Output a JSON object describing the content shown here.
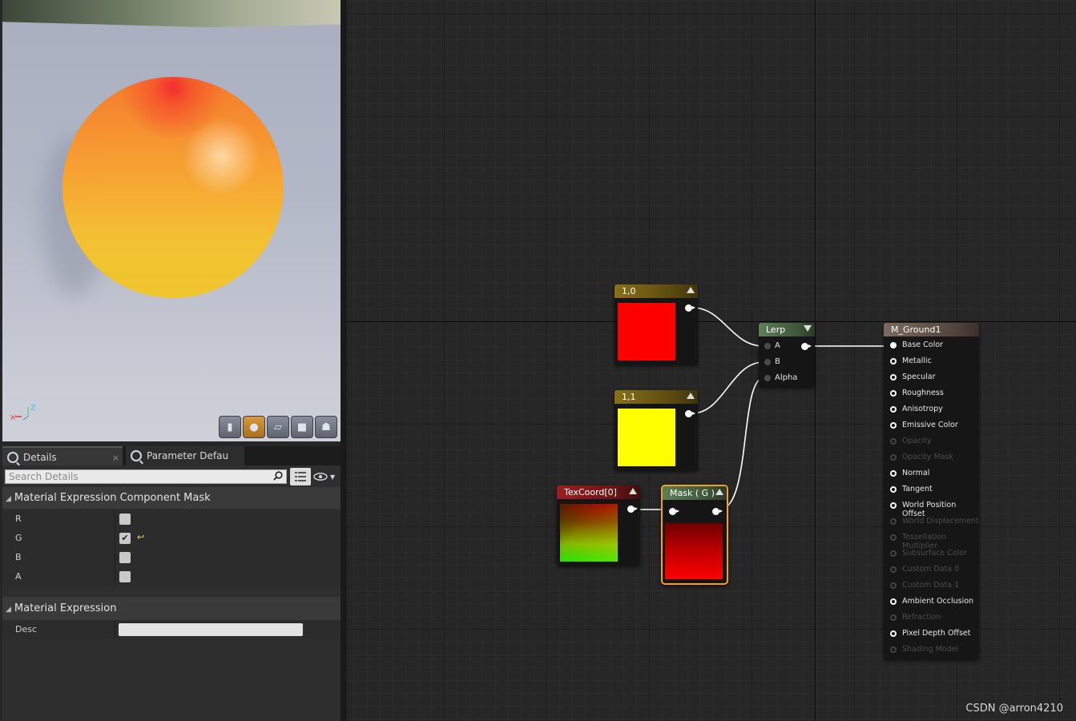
{
  "viewport": {
    "axis_z_label": "Z",
    "buttons": [
      {
        "icon": "cylinder-icon",
        "glyph": "▮"
      },
      {
        "icon": "sphere-icon",
        "glyph": "●"
      },
      {
        "icon": "plane-icon",
        "glyph": "▱"
      },
      {
        "icon": "cube-icon",
        "glyph": "■"
      },
      {
        "icon": "teapot-icon",
        "glyph": "☗"
      }
    ],
    "active_button": 1
  },
  "tabs": {
    "details": "Details",
    "details_close": "×",
    "params": "Parameter Defaults"
  },
  "search": {
    "placeholder": "Search Details"
  },
  "sections": {
    "mask": {
      "title": "Material Expression Component Mask",
      "rows": [
        {
          "label": "R",
          "checked": false
        },
        {
          "label": "G",
          "checked": true
        },
        {
          "label": "B",
          "checked": false
        },
        {
          "label": "A",
          "checked": false
        }
      ]
    },
    "expr": {
      "title": "Material Expression",
      "desc_label": "Desc",
      "desc_value": ""
    }
  },
  "graph": {
    "nodes": {
      "const_red": {
        "title": "1,0",
        "color": "#ff0000",
        "header": "#7a6214"
      },
      "const_yellow": {
        "title": "1,1",
        "color": "#ffff00",
        "header": "#7a6214"
      },
      "texcoord": {
        "title": "TexCoord[0]",
        "header": "#8a1c1c"
      },
      "mask": {
        "title": "Mask ( G )",
        "header": "#4f6e4a",
        "selected_border": "#f0a21c"
      },
      "lerp": {
        "title": "Lerp",
        "header": "#4f6e4a",
        "inputs": [
          "A",
          "B",
          "Alpha"
        ]
      },
      "material": {
        "title": "M_Ground1",
        "header": "#6e5d52",
        "inputs": [
          {
            "label": "Base Color",
            "state": "connected"
          },
          {
            "label": "Metallic",
            "state": "active"
          },
          {
            "label": "Specular",
            "state": "active"
          },
          {
            "label": "Roughness",
            "state": "active"
          },
          {
            "label": "Anisotropy",
            "state": "active"
          },
          {
            "label": "Emissive Color",
            "state": "active"
          },
          {
            "label": "Opacity",
            "state": "disabled"
          },
          {
            "label": "Opacity Mask",
            "state": "disabled"
          },
          {
            "label": "Normal",
            "state": "active"
          },
          {
            "label": "Tangent",
            "state": "active"
          },
          {
            "label": "World Position Offset",
            "state": "active"
          },
          {
            "label": "World Displacement",
            "state": "disabled"
          },
          {
            "label": "Tessellation Multiplier",
            "state": "disabled"
          },
          {
            "label": "Subsurface Color",
            "state": "disabled"
          },
          {
            "label": "Custom Data 0",
            "state": "disabled"
          },
          {
            "label": "Custom Data 1",
            "state": "disabled"
          },
          {
            "label": "Ambient Occlusion",
            "state": "active"
          },
          {
            "label": "Refraction",
            "state": "disabled"
          },
          {
            "label": "Pixel Depth Offset",
            "state": "active"
          },
          {
            "label": "Shading Model",
            "state": "disabled"
          }
        ]
      }
    }
  },
  "watermark": "CSDN @arron4210"
}
